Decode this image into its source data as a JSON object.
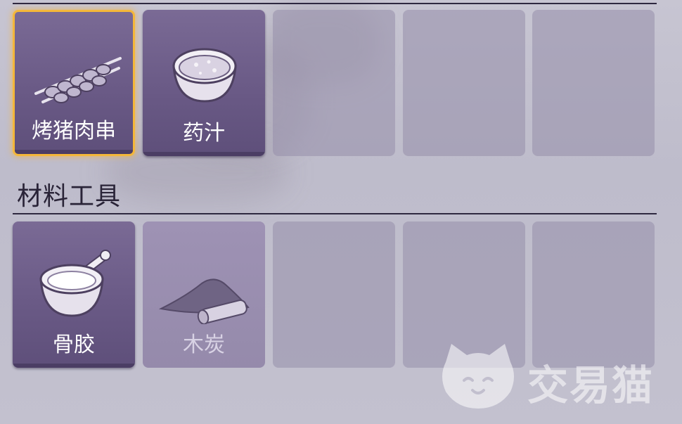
{
  "sections": [
    {
      "title": "",
      "slots": [
        {
          "label": "烤猪肉串",
          "icon": "meat-skewer-icon",
          "state": "selected"
        },
        {
          "label": "药汁",
          "icon": "potion-bowl-icon",
          "state": "filled"
        },
        {
          "label": "",
          "state": "empty"
        },
        {
          "label": "",
          "state": "empty"
        },
        {
          "label": "",
          "state": "empty"
        }
      ]
    },
    {
      "title": "材料工具",
      "slots": [
        {
          "label": "骨胶",
          "icon": "bone-glue-mortar-icon",
          "state": "filled"
        },
        {
          "label": "木炭",
          "icon": "charcoal-icon",
          "state": "dim"
        },
        {
          "label": "",
          "state": "empty"
        },
        {
          "label": "",
          "state": "empty"
        },
        {
          "label": "",
          "state": "empty"
        }
      ]
    }
  ],
  "watermark": {
    "text": "交易猫",
    "icon": "cat-logo-icon"
  },
  "colors": {
    "slot_fill": "#6a5a86",
    "selected_border": "#f4b73a",
    "empty_slot": "#9a93ad"
  }
}
